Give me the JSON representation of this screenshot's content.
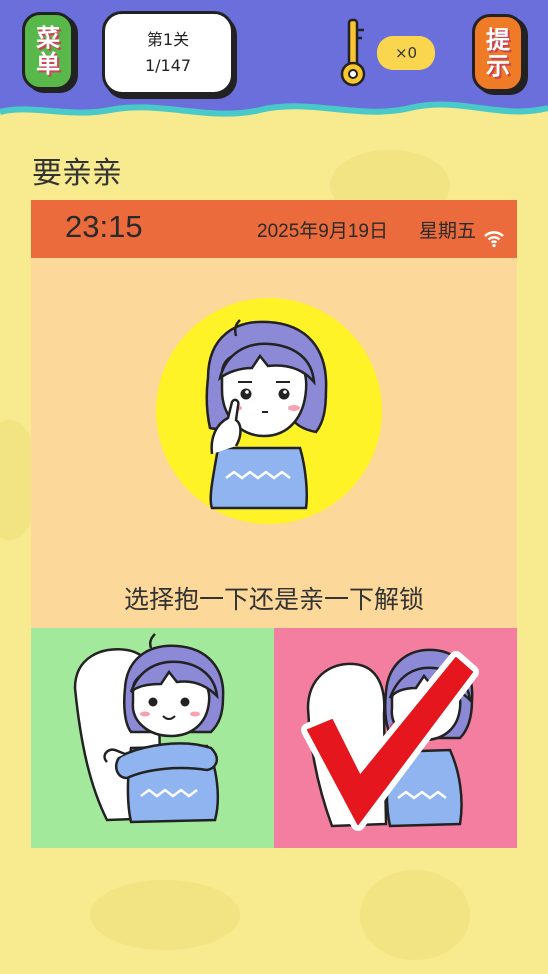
{
  "header": {
    "menu_button": {
      "line1": "菜",
      "line2": "单"
    },
    "level": {
      "label": "第1关",
      "progress": "1/147"
    },
    "key_count": "×0",
    "hint_button": {
      "line1": "提",
      "line2": "示"
    }
  },
  "puzzle": {
    "title": "要亲亲"
  },
  "phone": {
    "status_bar": {
      "time": "23:15",
      "date": "2025年9月19日",
      "weekday": "星期五",
      "wifi_icon": "wifi-icon"
    },
    "instruction": "选择抱一下还是亲一下解锁",
    "choices": [
      {
        "id": "hug",
        "icon": "hug-illustration",
        "color": "#a3e99b"
      },
      {
        "id": "kiss",
        "icon": "kiss-illustration",
        "color": "#f47e9f",
        "marked": "checkmark-icon"
      }
    ]
  },
  "colors": {
    "background": "#f7ea8f",
    "header": "#6b6fdc",
    "status_bar": "#ec6b3d",
    "screen": "#fcd89a",
    "avatar_circle": "#fdf327"
  }
}
